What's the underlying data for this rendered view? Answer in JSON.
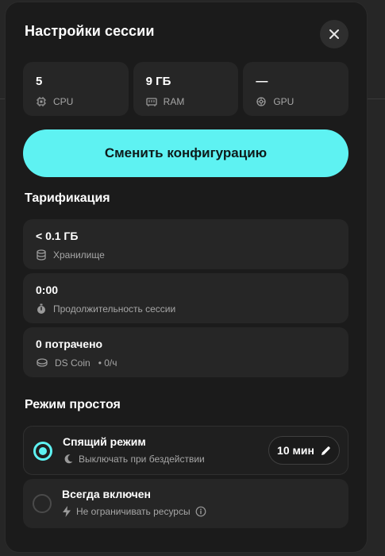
{
  "dialog": {
    "title": "Настройки сессии",
    "close_icon": "close-icon"
  },
  "specs": [
    {
      "value": "5",
      "label": "CPU",
      "icon": "cpu-icon"
    },
    {
      "value": "9 ГБ",
      "label": "RAM",
      "icon": "ram-icon"
    },
    {
      "value": "—",
      "label": "GPU",
      "icon": "gpu-icon"
    }
  ],
  "change_button": {
    "label": "Сменить конфигурацию",
    "color": "#5ef2f2"
  },
  "billing": {
    "title": "Тарификация",
    "items": [
      {
        "value": "< 0.1 ГБ",
        "label": "Хранилище",
        "icon": "database-icon"
      },
      {
        "value": "0:00",
        "label": "Продолжительность сессии",
        "icon": "stopwatch-icon"
      },
      {
        "value": "0 потрачено",
        "label": "DS Coin",
        "sub": "• 0/ч",
        "icon": "coins-icon"
      }
    ]
  },
  "idle": {
    "title": "Режим простоя",
    "options": [
      {
        "name": "Спящий режим",
        "desc": "Выключать при бездействии",
        "icon": "moon-icon",
        "selected": true,
        "timeout": "10 мин"
      },
      {
        "name": "Всегда включен",
        "desc": "Не ограничивать ресурсы",
        "icon": "lightning-icon",
        "selected": false
      }
    ]
  }
}
